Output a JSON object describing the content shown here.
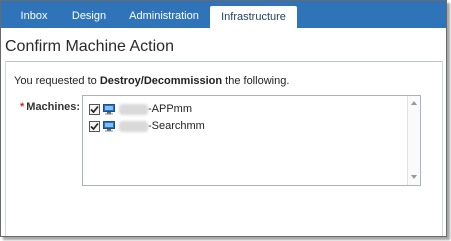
{
  "tabs": [
    {
      "label": "Inbox"
    },
    {
      "label": "Design"
    },
    {
      "label": "Administration"
    },
    {
      "label": "Infrastructure",
      "active": true
    }
  ],
  "page": {
    "title": "Confirm Machine Action",
    "message_prefix": "You requested to ",
    "action": "Destroy/Decommission",
    "message_suffix": " the following."
  },
  "machines_field": {
    "required_marker": "*",
    "label": "Machines:",
    "items": [
      {
        "name": "-APPmm",
        "checked": true,
        "icon": "computer-icon"
      },
      {
        "name": "-Searchmm",
        "checked": true,
        "icon": "computer-icon"
      }
    ]
  },
  "colors": {
    "tab_bar": "#2f74b8",
    "active_tab_text": "#1f3d5a",
    "required": "#d22"
  }
}
